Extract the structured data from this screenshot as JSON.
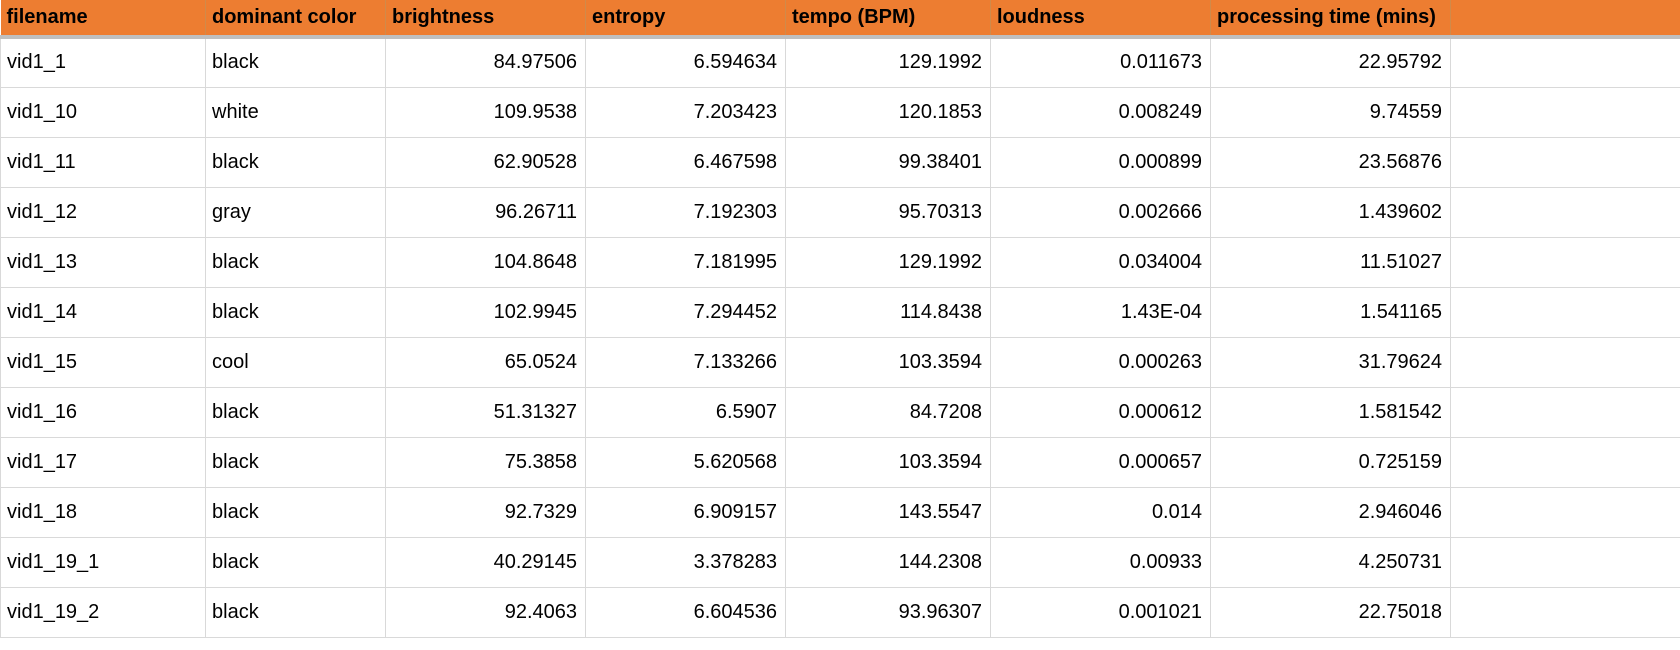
{
  "table": {
    "headers": [
      "filename",
      "dominant color",
      "brightness",
      "entropy",
      "tempo (BPM)",
      "loudness",
      "processing time (mins)",
      ""
    ],
    "col_types": [
      "txt",
      "txt",
      "num",
      "num",
      "num",
      "num",
      "num",
      "txt"
    ],
    "rows": [
      {
        "cells": [
          "vid1_1",
          "black",
          "84.97506",
          "6.594634",
          "129.1992",
          "0.011673",
          "22.95792",
          ""
        ]
      },
      {
        "cells": [
          "vid1_10",
          "white",
          "109.9538",
          "7.203423",
          "120.1853",
          "0.008249",
          "9.74559",
          ""
        ]
      },
      {
        "cells": [
          "vid1_11",
          "black",
          "62.90528",
          "6.467598",
          "99.38401",
          "0.000899",
          "23.56876",
          ""
        ]
      },
      {
        "cells": [
          "vid1_12",
          "gray",
          "96.26711",
          "7.192303",
          "95.70313",
          "0.002666",
          "1.439602",
          ""
        ]
      },
      {
        "cells": [
          "vid1_13",
          "black",
          "104.8648",
          "7.181995",
          "129.1992",
          "0.034004",
          "11.51027",
          ""
        ]
      },
      {
        "cells": [
          "vid1_14",
          "black",
          "102.9945",
          "7.294452",
          "114.8438",
          "1.43E-04",
          "1.541165",
          ""
        ]
      },
      {
        "cells": [
          "vid1_15",
          "cool",
          "65.0524",
          "7.133266",
          "103.3594",
          "0.000263",
          "31.79624",
          ""
        ]
      },
      {
        "cells": [
          "vid1_16",
          "black",
          "51.31327",
          "6.5907",
          "84.7208",
          "0.000612",
          "1.581542",
          ""
        ]
      },
      {
        "cells": [
          "vid1_17",
          "black",
          "75.3858",
          "5.620568",
          "103.3594",
          "0.000657",
          "0.725159",
          ""
        ]
      },
      {
        "cells": [
          "vid1_18",
          "black",
          "92.7329",
          "6.909157",
          "143.5547",
          "0.014",
          "2.946046",
          ""
        ]
      },
      {
        "cells": [
          "vid1_19_1",
          "black",
          "40.29145",
          "3.378283",
          "144.2308",
          "0.00933",
          "4.250731",
          ""
        ]
      },
      {
        "cells": [
          "vid1_19_2",
          "black",
          "92.4063",
          "6.604536",
          "93.96307",
          "0.001021",
          "22.75018",
          ""
        ]
      }
    ]
  }
}
